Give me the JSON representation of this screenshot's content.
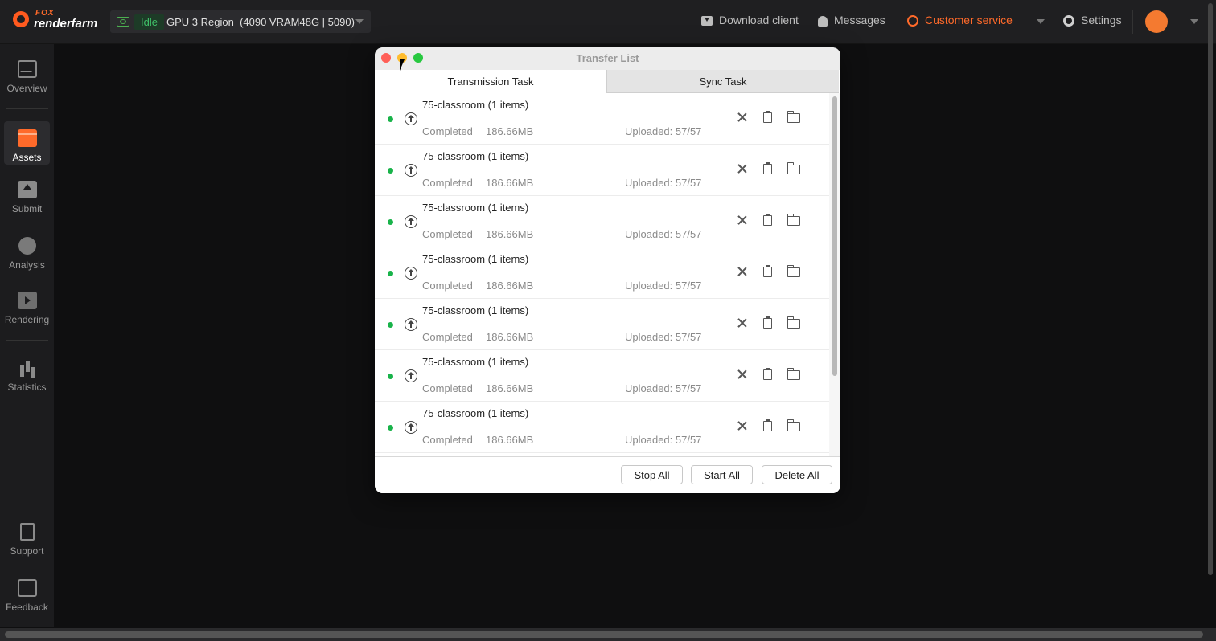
{
  "topbar": {
    "logo_top": "FOX",
    "logo_bottom": "renderfarm",
    "region_status": "Idle",
    "region_label": "GPU 3 Region",
    "region_detail": "(4090 VRAM48G | 5090)",
    "download_label": "Download client",
    "messages_label": "Messages",
    "customer_label": "Customer service",
    "settings_label": "Settings",
    "accent_color": "#ff6a2a"
  },
  "sidebar": {
    "items": [
      {
        "label": "Overview",
        "icon": "activity-icon"
      },
      {
        "label": "Assets",
        "icon": "folder-icon"
      },
      {
        "label": "Submit",
        "icon": "upload-icon"
      },
      {
        "label": "Analysis",
        "icon": "pie-icon"
      },
      {
        "label": "Rendering",
        "icon": "play-icon"
      },
      {
        "label": "Statistics",
        "icon": "bar-chart-icon"
      }
    ],
    "bottom": [
      {
        "label": "Support",
        "icon": "document-icon"
      },
      {
        "label": "Feedback",
        "icon": "message-icon"
      }
    ]
  },
  "dialog": {
    "title": "Transfer List",
    "tabs": [
      "Transmission Task",
      "Sync Task"
    ],
    "rows": [
      {
        "name": "75-classroom  (1 items)",
        "status": "Completed",
        "size": "186.66MB",
        "uploaded": "Uploaded: 57/57"
      },
      {
        "name": "75-classroom  (1 items)",
        "status": "Completed",
        "size": "186.66MB",
        "uploaded": "Uploaded: 57/57"
      },
      {
        "name": "75-classroom  (1 items)",
        "status": "Completed",
        "size": "186.66MB",
        "uploaded": "Uploaded: 57/57"
      },
      {
        "name": "75-classroom  (1 items)",
        "status": "Completed",
        "size": "186.66MB",
        "uploaded": "Uploaded: 57/57"
      },
      {
        "name": "75-classroom  (1 items)",
        "status": "Completed",
        "size": "186.66MB",
        "uploaded": "Uploaded: 57/57"
      },
      {
        "name": "75-classroom  (1 items)",
        "status": "Completed",
        "size": "186.66MB",
        "uploaded": "Uploaded: 57/57"
      },
      {
        "name": "75-classroom  (1 items)",
        "status": "Completed",
        "size": "186.66MB",
        "uploaded": "Uploaded: 57/57"
      }
    ],
    "buttons": {
      "stop_all": "Stop All",
      "start_all": "Start All",
      "delete_all": "Delete All"
    }
  }
}
